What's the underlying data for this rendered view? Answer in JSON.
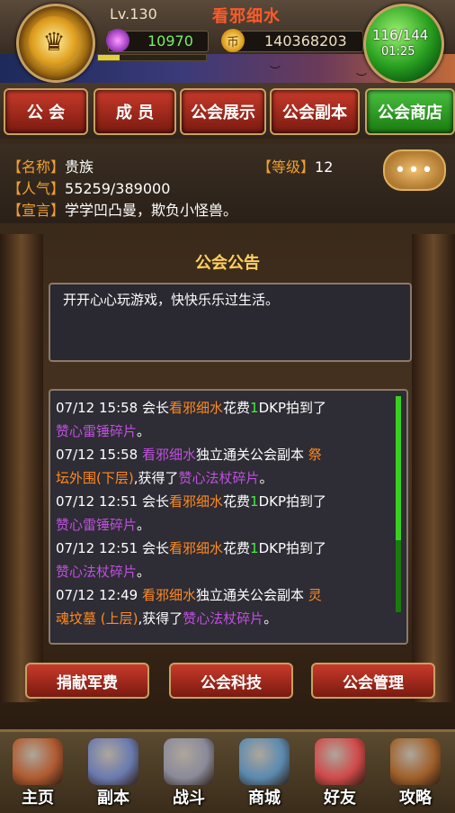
{
  "player": {
    "level": "Lv.130",
    "name": "看邪细水",
    "gems": "10970",
    "coins": "140368203",
    "energy": "116/144",
    "energy_timer": "01:25",
    "exp_fraction": 0.2
  },
  "tabs": [
    {
      "label": "公 会",
      "active": false
    },
    {
      "label": "成 员",
      "active": false
    },
    {
      "label": "公会展示",
      "active": false
    },
    {
      "label": "公会副本",
      "active": false
    },
    {
      "label": "公会商店",
      "active": true
    }
  ],
  "guild": {
    "name_label": "【名称】",
    "name": "贵族",
    "popularity_label": "【人气】",
    "popularity": "55259/389000",
    "level_label": "【等级】",
    "level": "12",
    "motto_label": "【宣言】",
    "motto": "学学凹凸曼，欺负小怪兽。",
    "chat_button": "•••"
  },
  "notice": {
    "title": "公会公告",
    "text": "开开心心玩游戏，快快乐乐过生活。"
  },
  "log_lines": [
    [
      {
        "t": "07/12 15:58 会长",
        "c": ""
      },
      {
        "t": "看邪细水",
        "c": "o"
      },
      {
        "t": "花费",
        "c": ""
      },
      {
        "t": "1",
        "c": "g"
      },
      {
        "t": "DKP拍到了",
        "c": ""
      }
    ],
    [
      {
        "t": "赞心雷锤碎片",
        "c": "p"
      },
      {
        "t": "。",
        "c": ""
      }
    ],
    [
      {
        "t": "07/12 15:58 ",
        "c": ""
      },
      {
        "t": "看邪细水",
        "c": "p"
      },
      {
        "t": "独立通关公会副本 ",
        "c": ""
      },
      {
        "t": "祭",
        "c": "o"
      }
    ],
    [
      {
        "t": "坛外围(下层)",
        "c": "o"
      },
      {
        "t": ",获得了",
        "c": ""
      },
      {
        "t": "赞心法杖碎片",
        "c": "p"
      },
      {
        "t": "。",
        "c": ""
      }
    ],
    [
      {
        "t": "07/12 12:51 会长",
        "c": ""
      },
      {
        "t": "看邪细水",
        "c": "o"
      },
      {
        "t": "花费",
        "c": ""
      },
      {
        "t": "1",
        "c": "g"
      },
      {
        "t": "DKP拍到了",
        "c": ""
      }
    ],
    [
      {
        "t": "赞心雷锤碎片",
        "c": "p"
      },
      {
        "t": "。",
        "c": ""
      }
    ],
    [
      {
        "t": "07/12 12:51 会长",
        "c": ""
      },
      {
        "t": "看邪细水",
        "c": "o"
      },
      {
        "t": "花费",
        "c": ""
      },
      {
        "t": "1",
        "c": "g"
      },
      {
        "t": "DKP拍到了",
        "c": ""
      }
    ],
    [
      {
        "t": "赞心法杖碎片",
        "c": "p"
      },
      {
        "t": "。",
        "c": ""
      }
    ],
    [
      {
        "t": "07/12 12:49 ",
        "c": ""
      },
      {
        "t": "看邪细水",
        "c": "o"
      },
      {
        "t": "独立通关公会副本 ",
        "c": ""
      },
      {
        "t": "灵",
        "c": "o"
      }
    ],
    [
      {
        "t": "魂坟墓 (上层)",
        "c": "o"
      },
      {
        "t": ",获得了",
        "c": ""
      },
      {
        "t": "赞心法杖碎片",
        "c": "p"
      },
      {
        "t": "。",
        "c": ""
      }
    ]
  ],
  "actions": {
    "donate": "捐献军费",
    "tech": "公会科技",
    "manage": "公会管理"
  },
  "dock": [
    {
      "label": "主页",
      "icon": "house-icon",
      "color": "#b05a30"
    },
    {
      "label": "副本",
      "icon": "wizard-icon",
      "color": "#6a7ab0"
    },
    {
      "label": "战斗",
      "icon": "swords-icon",
      "color": "#8a8a9a"
    },
    {
      "label": "商城",
      "icon": "monster-shop-icon",
      "color": "#5a8ab0"
    },
    {
      "label": "好友",
      "icon": "balloon-friends-icon",
      "color": "#d04a4a"
    },
    {
      "label": "攻略",
      "icon": "book-icon",
      "color": "#a0602a"
    }
  ]
}
